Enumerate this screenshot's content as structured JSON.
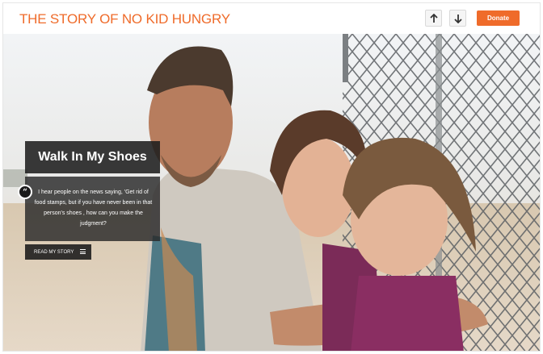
{
  "header": {
    "site_title": "THE STORY OF NO KID HUNGRY",
    "donate_label": "Donate",
    "colors": {
      "accent": "#ef6b2a"
    }
  },
  "nav": {
    "up_icon": "arrow-up-icon",
    "down_icon": "arrow-down-icon"
  },
  "story": {
    "title": "Walk In My Shoes",
    "quote_icon": "quote-icon",
    "quote_glyph": "“",
    "quote": "I hear people on the news saying, 'Get rid of food stamps, but if you have never been in that person's shoes , how can you make the judgment?",
    "read_label": "READ MY STORY",
    "read_icon": "menu-icon"
  }
}
